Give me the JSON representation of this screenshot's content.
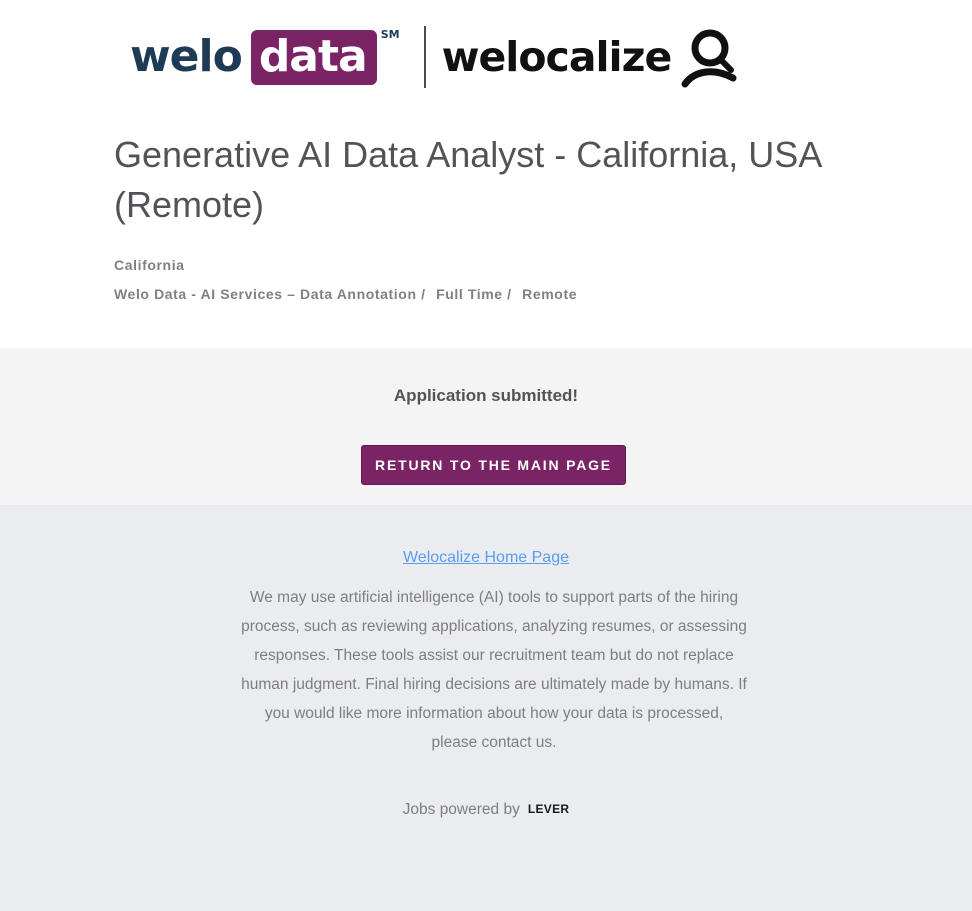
{
  "logo": {
    "welo": "welo",
    "data": "data",
    "sm": "SM",
    "welocalize": "welocalize",
    "brand_purple": "#7a2466",
    "brand_navy": "#1d3b55"
  },
  "posting": {
    "title": "Generative AI Data Analyst - California, USA (Remote)",
    "location": "California",
    "team": "Welo Data - AI Services – Data Annotation /",
    "commitment": "Full Time /",
    "workplace": "Remote"
  },
  "confirmation": {
    "message": "Application submitted!",
    "return_button": "RETURN TO THE MAIN PAGE"
  },
  "footer": {
    "home_link": "Welocalize Home Page",
    "ai_notice": "We may use artificial intelligence (AI) tools to support parts of the hiring process, such as reviewing applications, analyzing resumes, or assessing responses. These tools assist our recruitment team but do not replace human judgment. Final hiring decisions are ultimately made by humans. If you would like more information about how your data is processed, please contact us.",
    "powered_by": "Jobs powered by",
    "lever": "LEVER",
    "link_color": "#579eee"
  }
}
